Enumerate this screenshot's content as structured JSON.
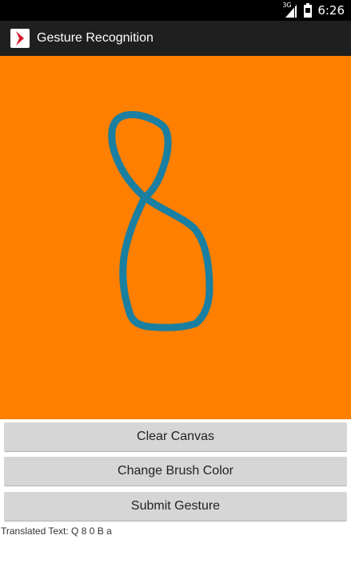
{
  "status_bar": {
    "network_label": "3G",
    "time": "6:26",
    "icons": [
      "signal-icon",
      "battery-icon"
    ]
  },
  "action_bar": {
    "title": "Gesture Recognition",
    "icon": "app-logo-icon"
  },
  "canvas": {
    "background_color": "#ff7f00",
    "brush_color": "#1a7fa0"
  },
  "buttons": {
    "clear_label": "Clear Canvas",
    "change_color_label": "Change Brush Color",
    "submit_label": "Submit Gesture"
  },
  "result": {
    "translated_text": "Translated Text: Q 8 0 B a"
  }
}
